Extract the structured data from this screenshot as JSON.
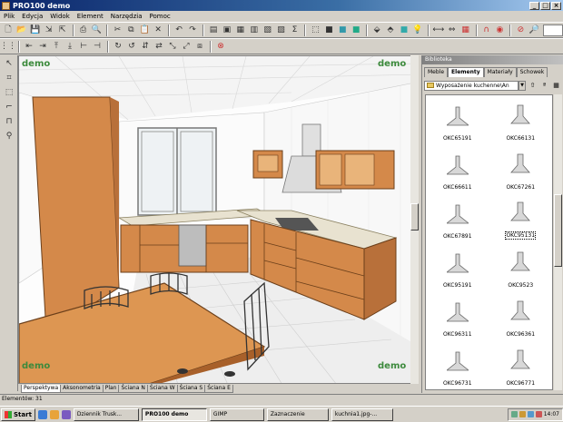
{
  "window": {
    "title": "PRO100 demo"
  },
  "menu": [
    "Plik",
    "Edycja",
    "Widok",
    "Element",
    "Narzędzia",
    "Pomoc"
  ],
  "viewport": {
    "watermarks": [
      "demo",
      "demo",
      "demo",
      "demo"
    ],
    "tabs": [
      "Perspektywa",
      "Aksonometria",
      "Plan",
      "Ściana N",
      "Ściana W",
      "Ściana S",
      "Ściana E"
    ],
    "active_tab": "Perspektywa"
  },
  "library": {
    "title": "Biblioteka",
    "tabs": [
      "Meble",
      "Elementy",
      "Materiały",
      "Schowek"
    ],
    "active_tab": "Elementy",
    "path": "Wyposażenie kuchenne\\An",
    "items": [
      "OKC65191",
      "OKC66131",
      "OKC66611",
      "OKC67261",
      "OKC67891",
      "OKC95131",
      "OKC95191",
      "OKC9523",
      "OKC96311",
      "OKC96361",
      "OKC96731",
      "OKC96771"
    ],
    "selected": "OKC95131"
  },
  "status": {
    "text": "Elementów: 31"
  },
  "taskbar": {
    "start": "Start",
    "buttons": [
      "Dziennik Trusk...",
      "PRO100 demo",
      "GIMP",
      "Zaznaczenie",
      "kuchnia1.jpg-..."
    ],
    "active": "PRO100 demo",
    "clock": "14:07"
  },
  "colors": {
    "wood": "#d4894a",
    "countertop": "#e8e2d0",
    "titlebar": "#0a246a",
    "watermark": "#3c8a3c"
  }
}
